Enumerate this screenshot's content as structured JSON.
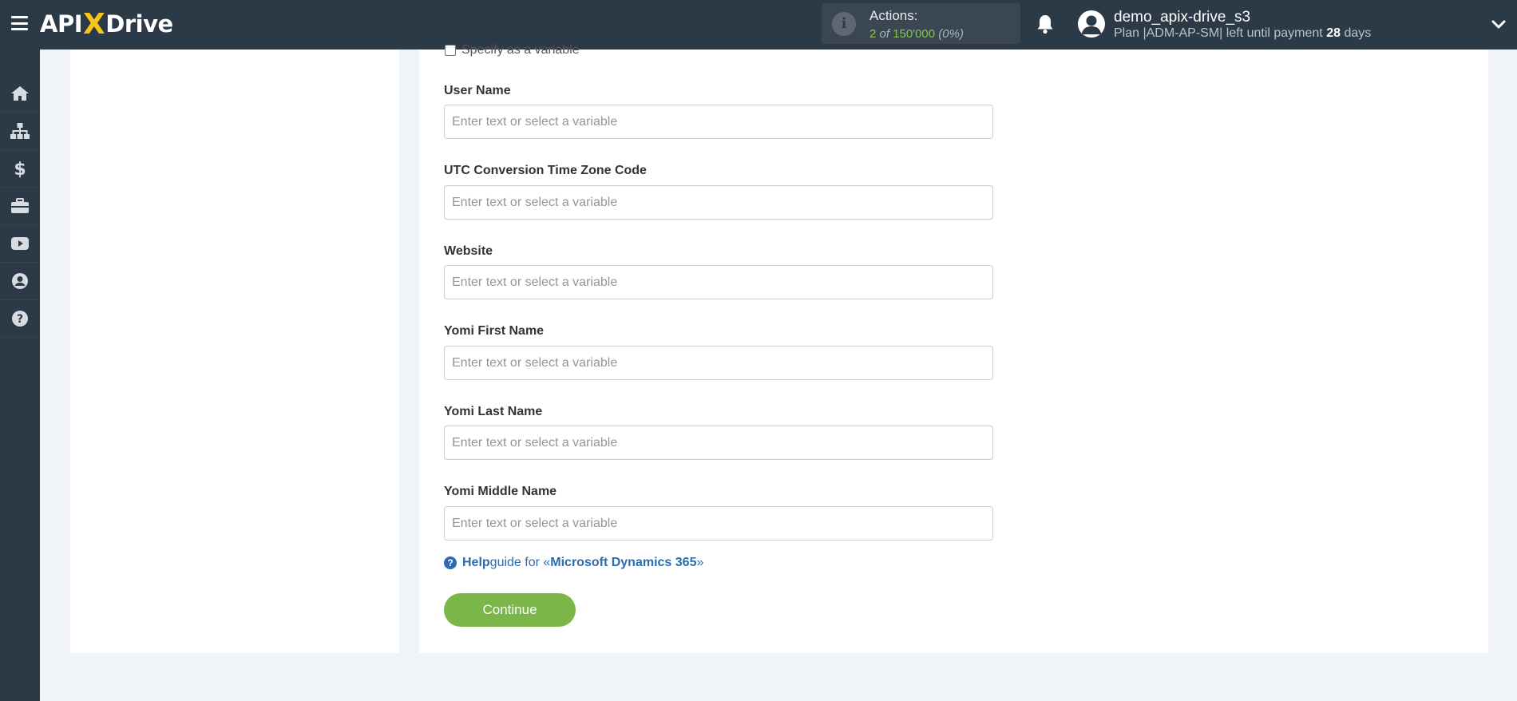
{
  "app": {
    "logo_left": "API",
    "logo_x": "X",
    "logo_right": "Drive"
  },
  "header": {
    "actions_label": "Actions:",
    "actions_used": "2",
    "actions_of": "of",
    "actions_total": "150'000",
    "actions_percent": "(0%)",
    "username": "demo_apix-drive_s3",
    "plan_prefix": "Plan |ADM-AP-SM| left until payment",
    "plan_days": "28",
    "plan_suffix": "days"
  },
  "sidebar": {
    "items": [
      {
        "icon": "home-icon"
      },
      {
        "icon": "sitemap-icon"
      },
      {
        "icon": "dollar-icon"
      },
      {
        "icon": "briefcase-icon"
      },
      {
        "icon": "youtube-icon"
      },
      {
        "icon": "user-circle-icon"
      },
      {
        "icon": "question-circle-icon"
      }
    ]
  },
  "form": {
    "checkbox_label": "Specify as a variable",
    "fields": [
      {
        "label": "User Name",
        "placeholder": "Enter text or select a variable",
        "value": ""
      },
      {
        "label": "UTC Conversion Time Zone Code",
        "placeholder": "Enter text or select a variable",
        "value": ""
      },
      {
        "label": "Website",
        "placeholder": "Enter text or select a variable",
        "value": ""
      },
      {
        "label": "Yomi First Name",
        "placeholder": "Enter text or select a variable",
        "value": ""
      },
      {
        "label": "Yomi Last Name",
        "placeholder": "Enter text or select a variable",
        "value": ""
      },
      {
        "label": "Yomi Middle Name",
        "placeholder": "Enter text or select a variable",
        "value": ""
      }
    ],
    "help_bold": "Help",
    "help_text": " guide for «",
    "help_link": "Microsoft Dynamics 365",
    "help_close": "»",
    "continue_label": "Continue"
  },
  "colors": {
    "topbar": "#2c3a47",
    "accent_green": "#7ab648",
    "link_blue": "#2d6bb0",
    "logo_yellow": "#f5c518"
  }
}
